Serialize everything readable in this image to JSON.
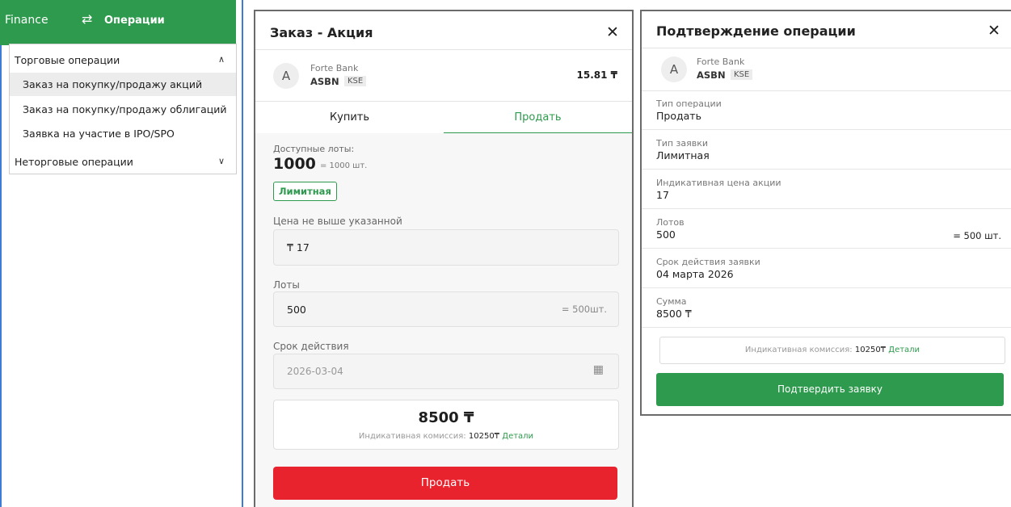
{
  "nav": {
    "brand": "Finance",
    "arrows_icon": "swap-arrows-icon",
    "section": "Операции",
    "groups": [
      {
        "label": "Торговые операции",
        "expanded": true,
        "items": [
          "Заказ на покупку/продажу акций",
          "Заказ на покупку/продажу облигаций",
          "Заявка на участие в IPO/SPO"
        ]
      },
      {
        "label": "Неторговые операции",
        "expanded": false,
        "items": []
      }
    ],
    "active_item": "Заказ на покупку/продажу акций"
  },
  "order": {
    "title": "Заказ - Акция",
    "close": "✕",
    "avatar_letter": "A",
    "bank": "Forte Bank",
    "ticker": "ASBN",
    "exchange": "KSE",
    "price": "15.81 ₸",
    "tabs": [
      "Купить",
      "Продать"
    ],
    "active_tab": "Продать",
    "lots_label": "Доступные лоты:",
    "lots_value": "1000",
    "lots_eq": "= 1000 шт.",
    "order_type": "Лимитная",
    "price_label": "Цена не выше указанной",
    "price_value": "₸  17",
    "qty_label": "Лоты",
    "qty_value": "500",
    "qty_eq": "= 500шт.",
    "term_label": "Срок действия",
    "term_value": "2026-03-04",
    "total": "8500 ₸",
    "commission_label": "Индикативная комиссия:",
    "commission_value": "10250₸",
    "details": "Детали",
    "submit": "Продать"
  },
  "confirm": {
    "title": "Подтверждение операции",
    "close": "✕",
    "avatar_letter": "A",
    "bank": "Forte Bank",
    "ticker": "ASBN",
    "exchange": "KSE",
    "fields": [
      {
        "label": "Тип операции",
        "value": "Продать"
      },
      {
        "label": "Тип заявки",
        "value": "Лимитная"
      },
      {
        "label": "Индикативная цена акции",
        "value": "17"
      },
      {
        "label": "Лотов",
        "value": "500",
        "extra": "= 500 шт."
      },
      {
        "label": "Срок действия заявки",
        "value": "04 марта 2026"
      },
      {
        "label": "Сумма",
        "value": "8500 ₸"
      }
    ],
    "commission_label": "Индикативная комиссия:",
    "commission_value": "10250₸",
    "details": "Детали",
    "submit": "Подтвердить заявку"
  },
  "colors": {
    "green": "#2e9a4d",
    "red": "#e9232d",
    "border_blue": "#3e7bd6"
  }
}
